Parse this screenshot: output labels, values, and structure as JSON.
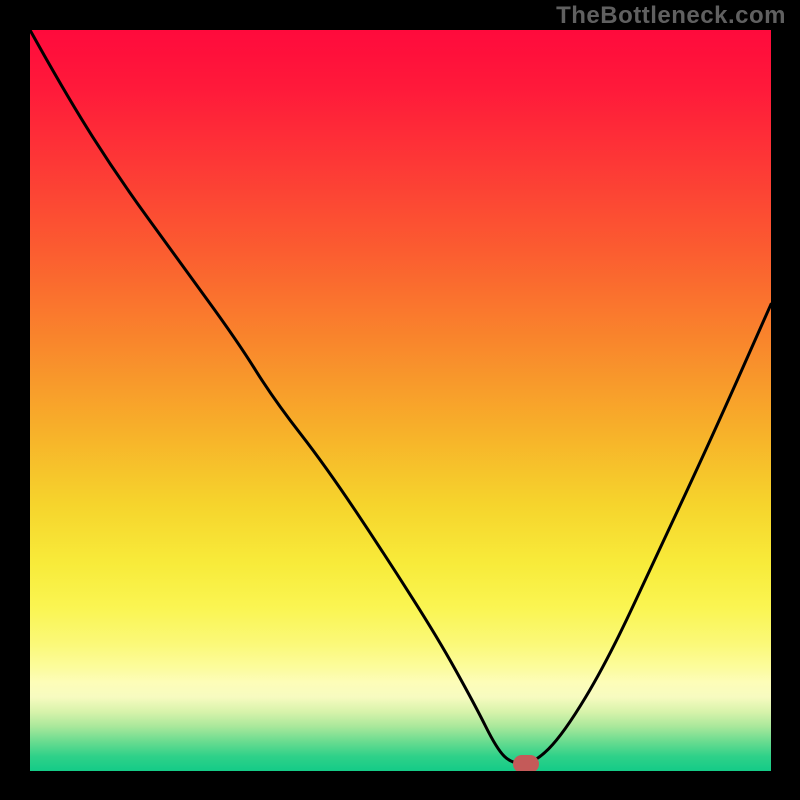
{
  "watermark": "TheBottleneck.com",
  "chart_data": {
    "type": "line",
    "title": "",
    "xlabel": "",
    "ylabel": "",
    "xlim": [
      0,
      100
    ],
    "ylim": [
      0,
      100
    ],
    "grid": false,
    "series": [
      {
        "name": "bottleneck-curve",
        "x": [
          0,
          5,
          12,
          20,
          28,
          33,
          40,
          48,
          55,
          60,
          63,
          65,
          68,
          72,
          78,
          85,
          92,
          100
        ],
        "y": [
          100,
          91,
          80,
          69,
          58,
          50,
          41,
          29,
          18,
          9,
          3,
          1,
          1,
          5,
          15,
          30,
          45,
          63
        ]
      }
    ],
    "marker": {
      "x": 67,
      "y": 1,
      "color": "#c45a59"
    },
    "background_gradient": {
      "top": "#ff0a3c",
      "mid": "#f6d42c",
      "bottom": "#14cb87"
    }
  }
}
